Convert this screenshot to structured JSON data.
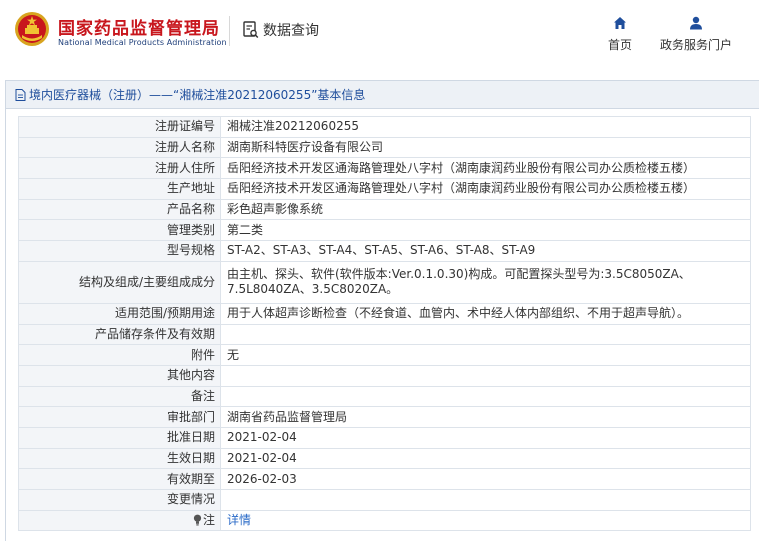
{
  "header": {
    "brand_cn": "国家药品监督管理局",
    "brand_en": "National Medical Products Administration",
    "data_query": "数据查询",
    "nav": {
      "home": "首页",
      "portal": "政务服务门户"
    }
  },
  "panel": {
    "title": "境内医疗器械（注册）——“湘械注准20212060255”基本信息"
  },
  "rows": [
    {
      "label": "注册证编号",
      "value": "湘械注准20212060255"
    },
    {
      "label": "注册人名称",
      "value": "湖南斯科特医疗设备有限公司"
    },
    {
      "label": "注册人住所",
      "value": "岳阳经济技术开发区通海路管理处八字村（湖南康润药业股份有限公司办公质检楼五楼）"
    },
    {
      "label": "生产地址",
      "value": "岳阳经济技术开发区通海路管理处八字村（湖南康润药业股份有限公司办公质检楼五楼）"
    },
    {
      "label": "产品名称",
      "value": "彩色超声影像系统"
    },
    {
      "label": "管理类别",
      "value": "第二类"
    },
    {
      "label": "型号规格",
      "value": "ST-A2、ST-A3、ST-A4、ST-A5、ST-A6、ST-A8、ST-A9"
    },
    {
      "label": "结构及组成/主要组成成分",
      "value": "由主机、探头、软件(软件版本:Ver.0.1.0.30)构成。可配置探头型号为:3.5C8050ZA、7.5L8040ZA、3.5C8020ZA。"
    },
    {
      "label": "适用范围/预期用途",
      "value": "用于人体超声诊断检查（不经食道、血管内、术中经人体内部组织、不用于超声导航）。"
    },
    {
      "label": "产品储存条件及有效期",
      "value": ""
    },
    {
      "label": "附件",
      "value": "无"
    },
    {
      "label": "其他内容",
      "value": ""
    },
    {
      "label": "备注",
      "value": ""
    },
    {
      "label": "审批部门",
      "value": "湖南省药品监督管理局"
    },
    {
      "label": "批准日期",
      "value": "2021-02-04"
    },
    {
      "label": "生效日期",
      "value": "2021-02-04"
    },
    {
      "label": "有效期至",
      "value": "2026-02-03"
    },
    {
      "label": "变更情况",
      "value": ""
    },
    {
      "label": "注",
      "value": "详情"
    }
  ],
  "colors": {
    "brand_red": "#c8161d",
    "nav_blue": "#1f4e9c",
    "link_blue": "#2a6ac7"
  },
  "icons": {
    "logo": "national-emblem-icon",
    "data_query": "document-search-icon",
    "home": "home-icon",
    "portal": "user-icon",
    "title": "document-icon",
    "note": "lightbulb-icon"
  }
}
